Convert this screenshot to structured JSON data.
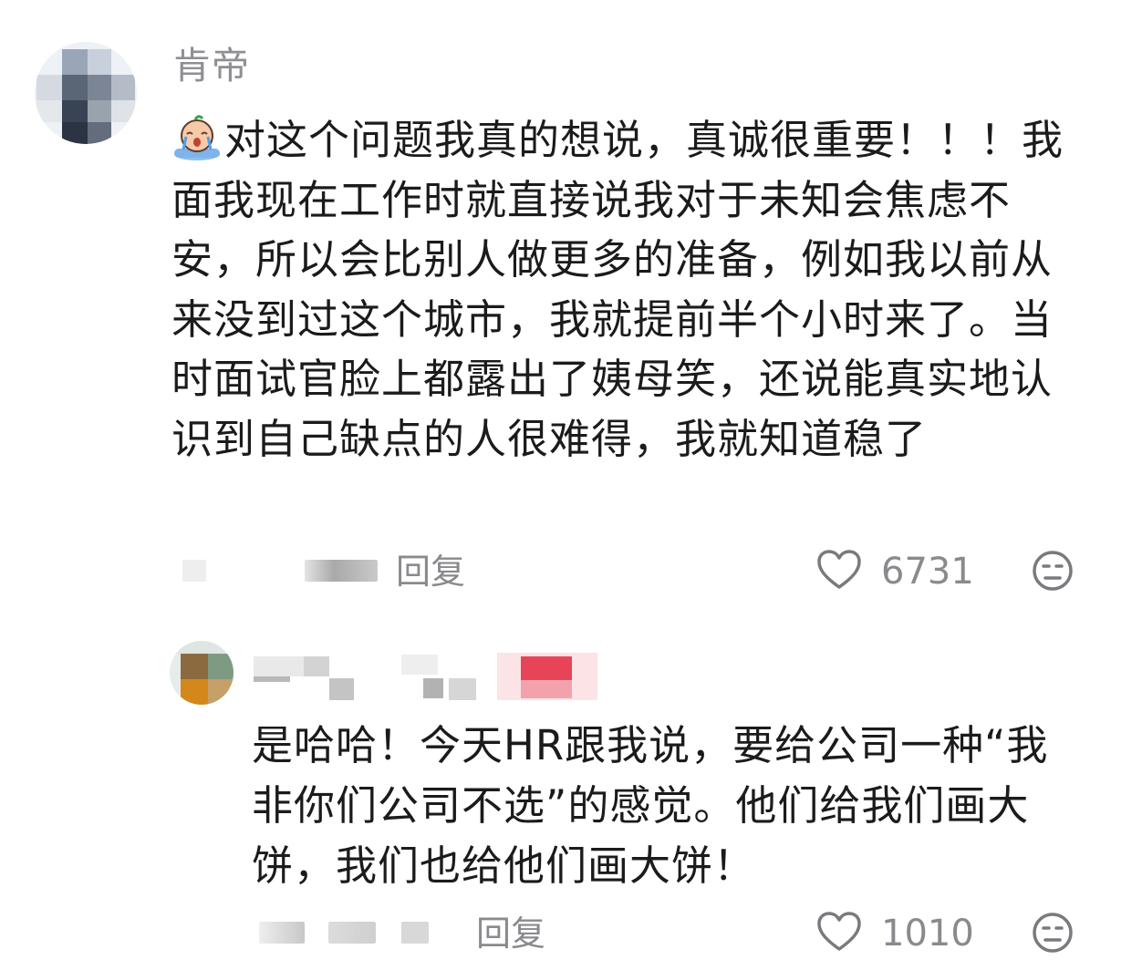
{
  "comment": {
    "username": "肯帝",
    "emoji_icon": "crying-face-emoji",
    "text": "对这个问题我真的想说，真诚很重要！！！我面我现在工作时就直接说我对于未知会焦虑不安，所以会比别人做更多的准备，例如我以前从来没到过这个城市，我就提前半个小时来了。当时面试官脸上都露出了姨母笑，还说能真实地认识到自己缺点的人很难得，我就知道稳了",
    "reply_label": "回复",
    "like_count": "6731",
    "icons": {
      "like": "heart-outline-icon",
      "dislike": "meh-face-icon"
    }
  },
  "reply": {
    "text": "是哈哈！今天HR跟我说，要给公司一种“我非你们公司不选”的感觉。他们给我们画大饼，我们也给他们画大饼！",
    "reply_label": "回复",
    "like_count": "1010",
    "icons": {
      "like": "heart-outline-icon",
      "dislike": "meh-face-icon"
    }
  },
  "colors": {
    "text_primary": "#1b1b1b",
    "text_secondary": "#8a8a8e",
    "background": "#ffffff"
  }
}
